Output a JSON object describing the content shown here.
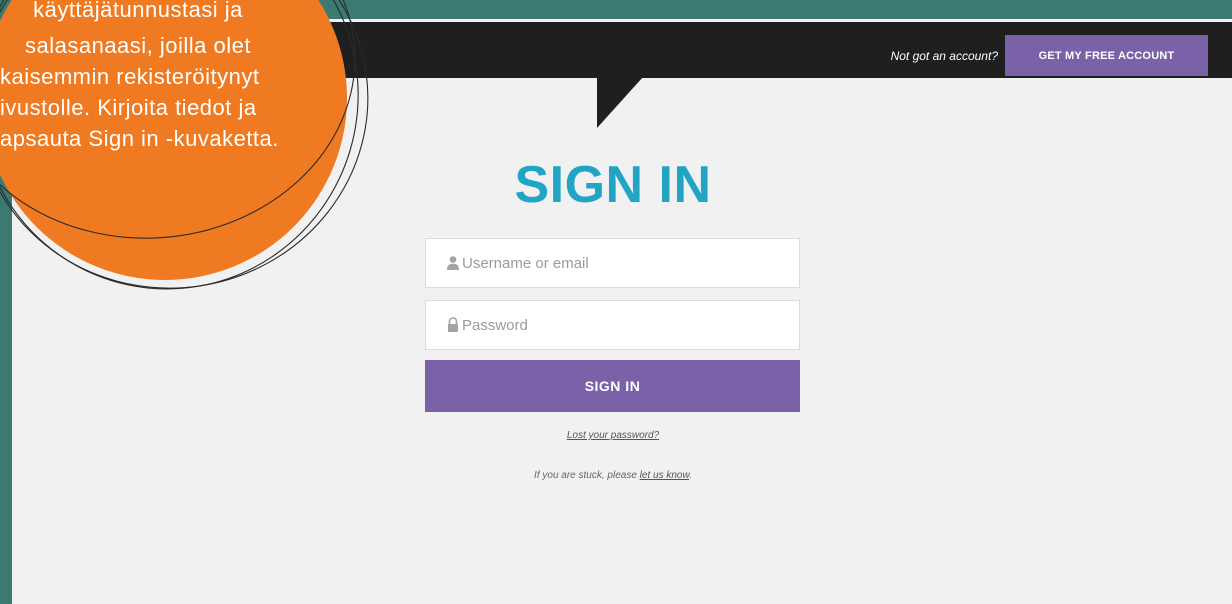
{
  "colors": {
    "frame": "#3b7a71",
    "page": "#f1f1f1",
    "header": "#1f1f1f",
    "accent": "#7b62a8",
    "heading": "#22a4c5",
    "callout": "#ef7a22"
  },
  "header": {
    "prompt": "Not got an account?",
    "cta_label": "GET MY FREE ACCOUNT"
  },
  "signin": {
    "title": "SIGN IN",
    "username": {
      "placeholder": "Username or email",
      "icon": "user-icon"
    },
    "password": {
      "placeholder": "Password",
      "icon": "lock-icon"
    },
    "submit_label": "SIGN IN",
    "lost_password": "Lost your password?",
    "help_prefix": "If you are stuck, please",
    "help_link": "let us know",
    "help_suffix": "."
  },
  "callout": {
    "lines": [
      "käyttäjätunnustasi ja",
      "salasanaasi, joilla olet",
      "kaisemmin rekisteröitynyt",
      "ivustolle. Kirjoita tiedot ja",
      "apsauta Sign in -kuvaketta."
    ]
  }
}
